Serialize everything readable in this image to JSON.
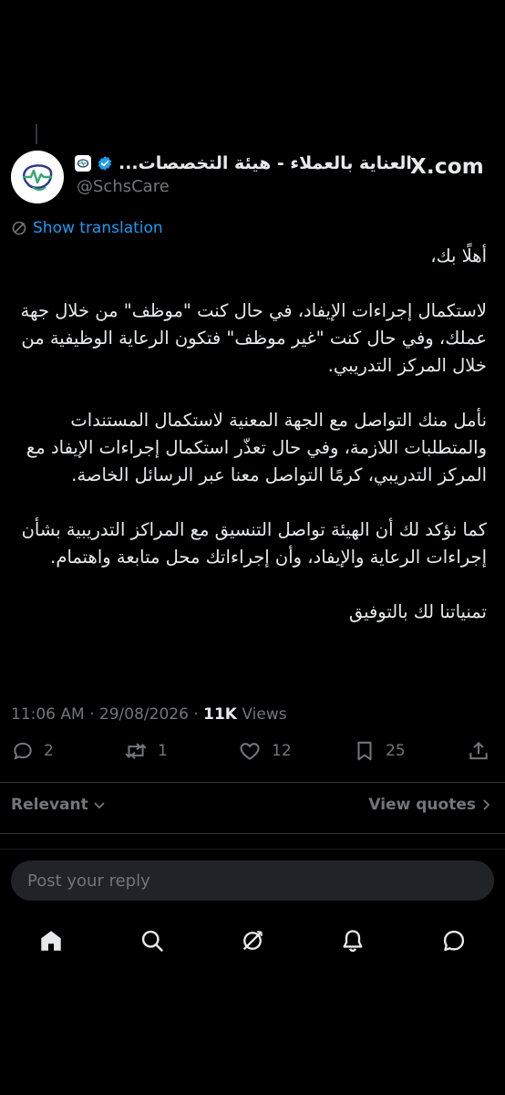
{
  "tweet": {
    "display_name": "العناية بالعملاء - هيئة التخصصات...",
    "handle": "@SchsCare",
    "source_label": "X.com",
    "translate_label": "Show translation",
    "body": [
      "أهلًا بك،",
      "لاستكمال إجراءات الإيفاد، في حال كنت \"موظف\" من خلال جهة عملك، وفي حال كنت \"غير موظف\" فتكون الرعاية الوظيفية من خلال المركز التدريبي.",
      "نأمل منك التواصل مع الجهة المعنية لاستكمال المستندات والمتطلبات اللازمة، وفي حال تعذّر استكمال إجراءات الإيفاد مع المركز التدريبي، كرمًا التواصل معنا عبر الرسائل الخاصة.",
      "كما نؤكد لك أن الهيئة تواصل التنسيق مع المراكز التدريبية بشأن إجراءات الرعاية والإيفاد، وأن إجراءاتك محل متابعة واهتمام.",
      "تمنياتنا لك بالتوفيق"
    ],
    "time": "11:06 AM",
    "date": "29/08/2026",
    "views_count": "11K",
    "views_label": "Views"
  },
  "actions": {
    "replies": "2",
    "reposts": "1",
    "likes": "12",
    "bookmarks": "25"
  },
  "sort": {
    "relevant_label": "Relevant",
    "view_quotes_label": "View quotes"
  },
  "reply": {
    "placeholder": "Post your reply"
  },
  "colors": {
    "background": "#000000",
    "text": "#e7e9ea",
    "muted": "#71767b",
    "accent": "#1d9bf0",
    "reply_box": "#202327"
  },
  "nav": {
    "items": [
      "home-icon",
      "search-icon",
      "grok-icon",
      "notifications-icon",
      "messages-icon"
    ]
  }
}
